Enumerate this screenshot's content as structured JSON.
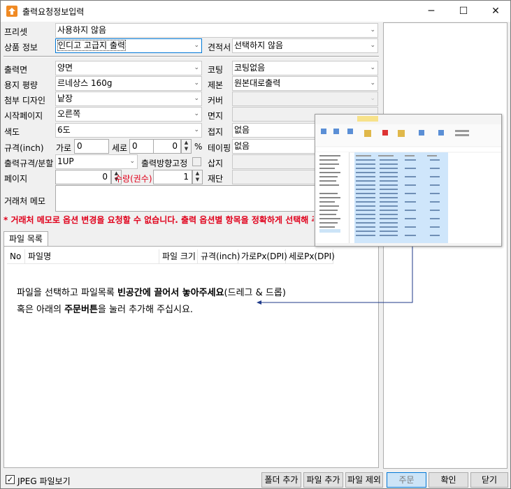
{
  "window": {
    "title": "출력요청정보입력",
    "minimize": "─",
    "maximize": "☐",
    "close": "✕"
  },
  "form": {
    "preset_label": "프리셋",
    "preset_value": "사용하지 않음",
    "product_label": "상품 정보",
    "product_value": "인디고 고급지 출력",
    "quote_label": "견적서",
    "quote_value": "선택하지 않음",
    "side_label": "출력면",
    "side_value": "양면",
    "coating_label": "코팅",
    "coating_value": "코팅없음",
    "paper_label": "용지 평량",
    "paper_value": "르네상스 160g",
    "binding_label": "제본",
    "binding_value": "원본대로출력",
    "attach_label": "첨부 디자인",
    "attach_value": "낱장",
    "cover_label": "커버",
    "cover_value": "",
    "start_label": "시작페이지",
    "start_value": "오른쪽",
    "endpaper_label": "면지",
    "endpaper_value": "",
    "color_label": "색도",
    "color_value": "6도",
    "fold_label": "접지",
    "fold_value": "없음",
    "size_label": "규격(inch)",
    "width_label": "가로",
    "width_value": "0",
    "height_label": "세로",
    "height_value": "0",
    "margin_value": "0",
    "percent": "%",
    "taping_label": "테이핑",
    "taping_value": "없음",
    "layout_label": "출력규격/분할",
    "layout_value": "1UP",
    "direction_label": "출력방향고정",
    "insert_label": "삽지",
    "pages_label": "페이지",
    "pages_value": "0",
    "qty_label": "수량(권수)",
    "qty_value": "1",
    "cut_label": "재단",
    "memo_label": "거래처 메모",
    "memo_value": ""
  },
  "warning": "* 거래처 메모로 옵션 변경을 요청할 수 없습니다. 출력 옵션별 항목을 정확하게 선택해 주세요.",
  "tabs": {
    "file_list": "파일 목록"
  },
  "table": {
    "columns": [
      "No",
      "파일명",
      "파일 크기",
      "규격(inch)",
      "가로Px(DPI)",
      "세로Px(DPI)"
    ]
  },
  "hint": {
    "line1_a": "파일을 선택하고 파일목록 ",
    "line1_b": "빈공간에 끌어서 놓아주세요",
    "line1_c": "(드레그 & 드롭)",
    "line2_a": "혹은 아래의 ",
    "line2_b": "주문버튼",
    "line2_c": "을 눌러 추가해 주십시요."
  },
  "footer": {
    "jpeg_label": "JPEG 파일보기",
    "jpeg_checked": "✓",
    "add_folder": "폴더 추가",
    "add_file": "파일 추가",
    "remove_file": "파일 제외",
    "order": "주문",
    "confirm": "확인",
    "close": "닫기"
  },
  "colors": {
    "warning": "#e0001b",
    "qty_label": "#e0001b",
    "app_icon": "#f08a24",
    "arrow_line": "#1f3a8a"
  }
}
